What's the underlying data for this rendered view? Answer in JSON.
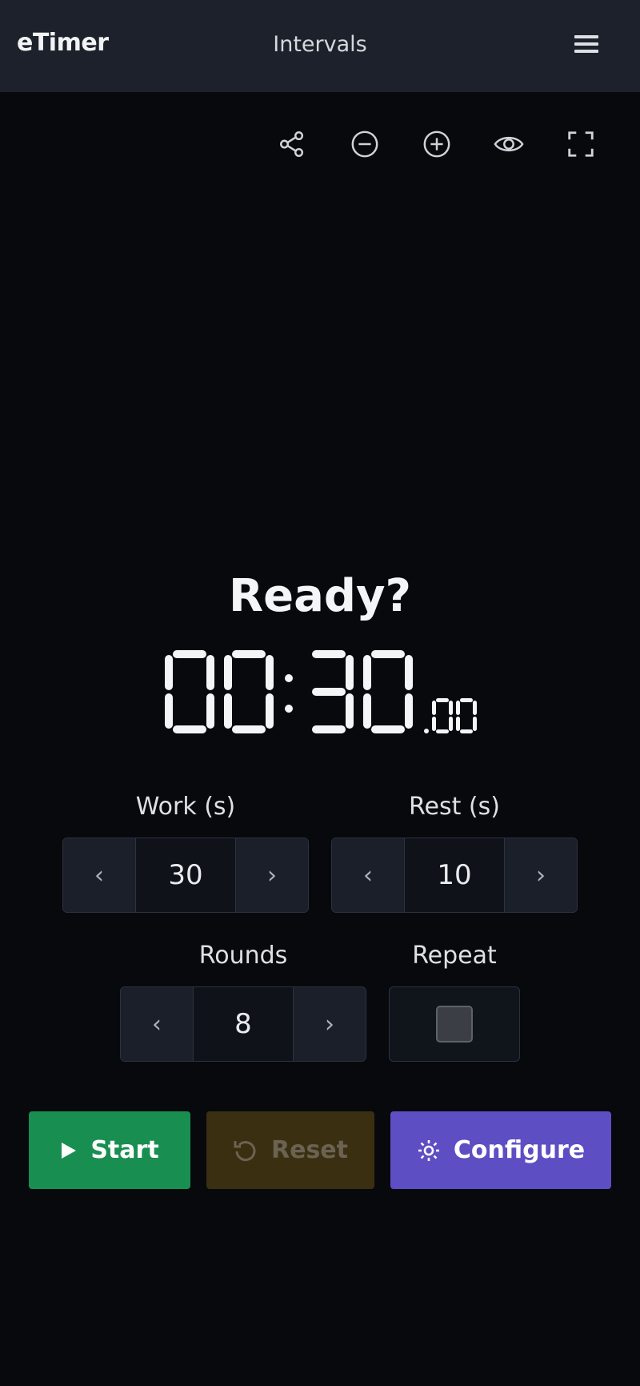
{
  "navbar": {
    "brand": "eTimer",
    "title": "Intervals"
  },
  "toolbar": {
    "icons": [
      "share-icon",
      "zoom-out-icon",
      "zoom-in-icon",
      "eye-icon",
      "fullscreen-icon"
    ]
  },
  "timer": {
    "status": "Ready?",
    "minutes": "00",
    "seconds": "30",
    "hundredths": "00"
  },
  "settings": {
    "work": {
      "label": "Work (s)",
      "value": "30"
    },
    "rest": {
      "label": "Rest (s)",
      "value": "10"
    },
    "rounds": {
      "label": "Rounds",
      "value": "8"
    },
    "repeat": {
      "label": "Repeat",
      "checked": false
    },
    "decrement_symbol": "‹",
    "increment_symbol": "›"
  },
  "actions": {
    "start": "Start",
    "reset": "Reset",
    "configure": "Configure"
  },
  "colors": {
    "start": "#188f50",
    "reset": "#3b2f12",
    "configure": "#5e4ec4",
    "navbar": "#1d212b",
    "background": "#07090d"
  }
}
